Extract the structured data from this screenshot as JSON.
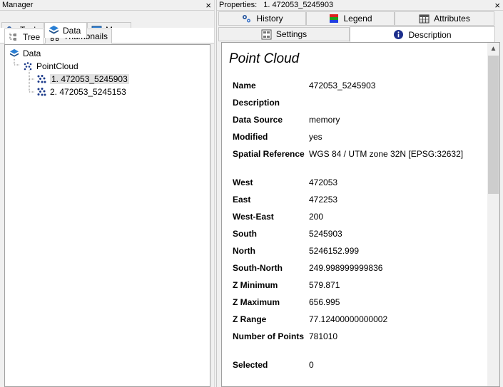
{
  "manager": {
    "title": "Manager",
    "tabs": [
      "Tools",
      "Data",
      "Maps"
    ],
    "active_tab": "Data",
    "subtabs": [
      "Tree",
      "Thumbnails"
    ],
    "tree": {
      "root": "Data",
      "group": "PointCloud",
      "items": [
        "1. 472053_5245903",
        "2. 472053_5245153"
      ],
      "selected_index": 0
    }
  },
  "properties": {
    "title_label": "Properties:",
    "title_value": "1. 472053_5245903",
    "tabs_row1": [
      "History",
      "Legend",
      "Attributes"
    ],
    "tabs_row2": [
      "Settings",
      "Description"
    ],
    "active_tab": "Description",
    "panel_title": "Point Cloud",
    "rows": [
      {
        "key": "Name",
        "value": "472053_5245903"
      },
      {
        "key": "Description",
        "value": ""
      },
      {
        "key": "Data Source",
        "value": "memory"
      },
      {
        "key": "Modified",
        "value": "yes"
      },
      {
        "key": "Spatial Reference",
        "value": "WGS 84 / UTM zone 32N [EPSG:32632]"
      },
      {
        "key": "West",
        "value": "472053"
      },
      {
        "key": "East",
        "value": "472253"
      },
      {
        "key": "West-East",
        "value": "200"
      },
      {
        "key": "South",
        "value": "5245903"
      },
      {
        "key": "North",
        "value": "5246152.999"
      },
      {
        "key": "South-North",
        "value": "249.998999999836"
      },
      {
        "key": "Z Minimum",
        "value": "579.871"
      },
      {
        "key": "Z Maximum",
        "value": "656.995"
      },
      {
        "key": "Z Range",
        "value": "77.12400000000002"
      },
      {
        "key": "Number of Points",
        "value": "781010"
      },
      {
        "key": "Selected",
        "value": "0"
      }
    ]
  },
  "icons": {
    "close": "×",
    "scroll_up": "▲"
  }
}
